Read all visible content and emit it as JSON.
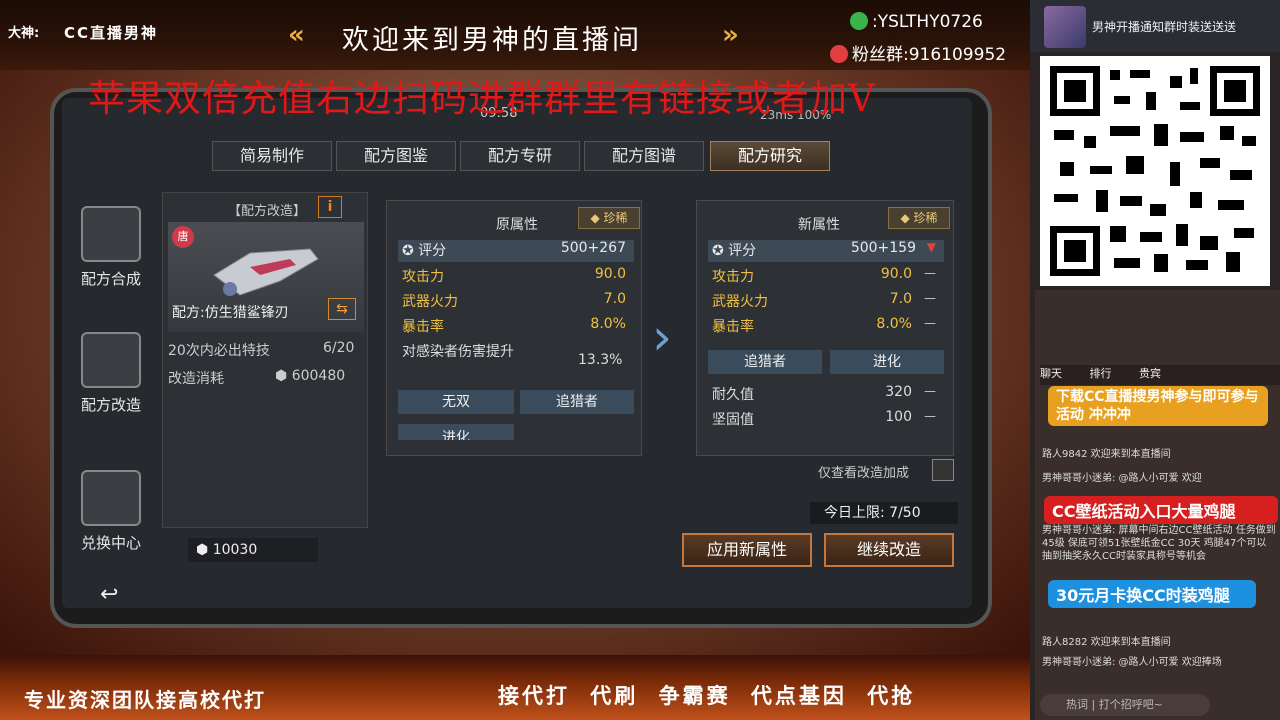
{
  "stream": {
    "host_label": "大神:",
    "host_name": "CC直播男神",
    "welcome": "欢迎来到男神的直播间",
    "wechat": "YSLTHY0726",
    "fans_group": "粉丝群:916109952",
    "headline": "苹果双倍充值右边扫码进群群里有链接或者加V",
    "bottom_left": "专业资深团队接高校代打",
    "bottom_right": "接代打 代刷 争霸赛 代点基因 代抢"
  },
  "game": {
    "status_time": "09:58",
    "status_right": "23ms 100%",
    "tabs": [
      "简易制作",
      "配方图鉴",
      "配方专研",
      "配方图谱",
      "配方研究"
    ],
    "active_tab": "配方研究",
    "sidebar": [
      "配方合成",
      "配方改造",
      "兑换中心"
    ],
    "item_panel": {
      "title": "【配方改造】",
      "info": "i",
      "rarity_badge": "唐",
      "weapon_name": "配方:仿生猎鲨锋刃",
      "guarantee_label": "20次内必出特技",
      "guarantee_val": "6/20",
      "cost_label": "改造消耗",
      "cost_val": "600480",
      "currency": "10030"
    },
    "original": {
      "header": "原属性",
      "rarity": "珍稀",
      "score_label": "评分",
      "score": "500+267",
      "attrs": [
        {
          "k": "攻击力",
          "v": "90.0"
        },
        {
          "k": "武器火力",
          "v": "7.0"
        },
        {
          "k": "暴击率",
          "v": "8.0%"
        }
      ],
      "extra_k": "对感染者伤害提升",
      "extra_v": "13.3%",
      "traits": [
        "无双",
        "追猎者",
        "进化"
      ]
    },
    "new": {
      "header": "新属性",
      "rarity": "珍稀",
      "score_label": "评分",
      "score": "500+159",
      "attrs": [
        {
          "k": "攻击力",
          "v": "90.0"
        },
        {
          "k": "武器火力",
          "v": "7.0"
        },
        {
          "k": "暴击率",
          "v": "8.0%"
        }
      ],
      "traits": [
        "追猎者",
        "进化"
      ],
      "plain": [
        {
          "k": "耐久值",
          "v": "320"
        },
        {
          "k": "坚固值",
          "v": "100"
        }
      ]
    },
    "only_view": "仅查看改造加成",
    "daily_limit": "今日上限:  7/50",
    "apply_btn": "应用新属性",
    "continue_btn": "继续改造",
    "back": "↩"
  },
  "right": {
    "notice": "男神开播通知群时装送送送",
    "chat_tabs": [
      "聊天",
      "排行",
      "贵宾"
    ],
    "ad_download": "下载CC直播搜男神参与即可参与活动 冲冲冲",
    "ad_wallpaper": "CC壁纸活动入口大量鸡腿",
    "ad_monthly": "30元月卡换CC时装鸡腿",
    "chat": [
      "路人9842 欢迎来到本直播间",
      "男神哥哥小迷弟: @路人小可爱 欢迎",
      "男神哥哥小迷弟: 屏幕中间右边CC壁纸活动 任务做到45级 保底可领51张壁纸金CC 30天 鸡腿47个可以抽到抽奖永久CC时装家具称号等机会",
      "路人8282 欢迎来到本直播间",
      "男神哥哥小迷弟: @路人小可爱 欢迎捧场"
    ],
    "chat_input": "热词  |  打个招呼吧~"
  },
  "colors": {
    "accent_gold": "#f2c040",
    "headline_red": "#e01818",
    "trait_blue": "#3a4c5c"
  }
}
